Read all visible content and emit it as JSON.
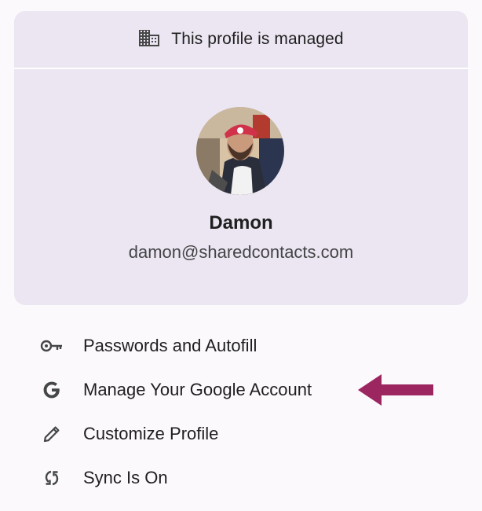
{
  "managed_banner": {
    "text": "This profile is managed",
    "icon": "building-icon"
  },
  "profile": {
    "name": "Damon",
    "email": "damon@sharedcontacts.com",
    "avatar": "profile-photo"
  },
  "menu": [
    {
      "label": "Passwords and Autofill",
      "icon": "key-icon"
    },
    {
      "label": "Manage Your Google Account",
      "icon": "google-icon"
    },
    {
      "label": "Customize Profile",
      "icon": "pencil-icon"
    },
    {
      "label": "Sync Is On",
      "icon": "sync-icon"
    }
  ],
  "annotation": {
    "icon": "arrow-left-icon",
    "color": "#9c2660"
  },
  "colors": {
    "card_bg": "#ebe6f2",
    "page_bg": "#fcf9fd"
  }
}
